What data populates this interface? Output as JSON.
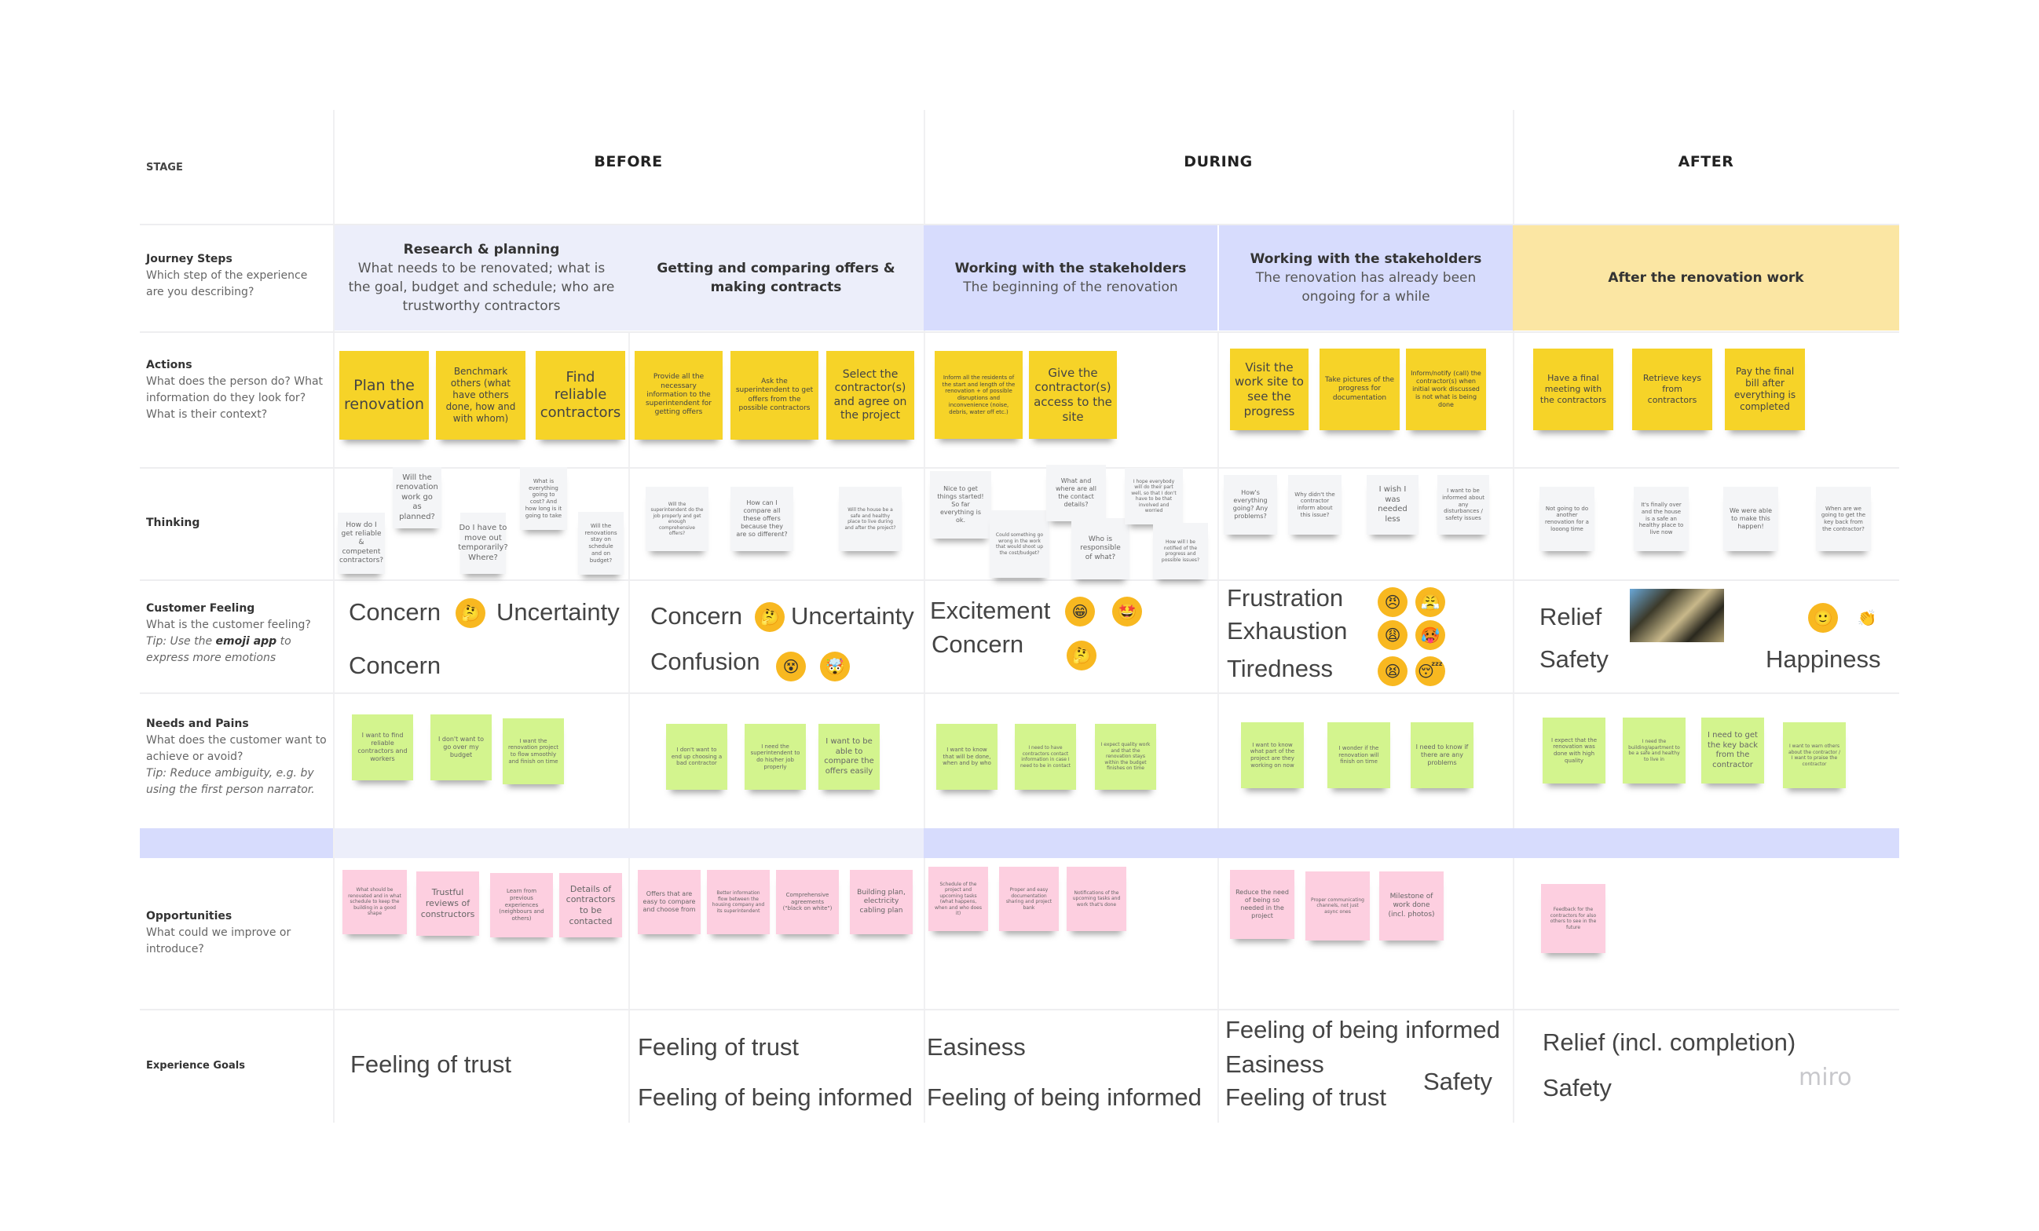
{
  "row_labels": {
    "stage": "STAGE",
    "journey": {
      "title": "Journey Steps",
      "desc": "Which step of the experience are you describing?"
    },
    "actions": {
      "title": "Actions",
      "desc": "What does the person do? What information do they look for? What is their context?"
    },
    "thinking": {
      "title": "Thinking"
    },
    "feeling": {
      "title": "Customer Feeling",
      "desc": "What is the customer feeling?",
      "tip_prefix": "Tip: Use the ",
      "tip_bold": "emoji app",
      "tip_suffix": " to express more emotions"
    },
    "needs": {
      "title": "Needs and Pains",
      "desc": "What does the customer want to achieve or avoid?",
      "tip": "Tip: Reduce ambiguity, e.g. by using the first person narrator."
    },
    "opportunities": {
      "title": "Opportunities",
      "desc": "What could we improve or introduce?"
    },
    "goals": {
      "title": "Experience Goals"
    }
  },
  "stages": [
    "BEFORE",
    "DURING",
    "AFTER"
  ],
  "journey_steps": [
    {
      "title": "Research & planning",
      "desc": "What needs to be renovated; what is the goal, budget and schedule; who are trustworthy contractors"
    },
    {
      "title": "Getting and comparing offers & making contracts",
      "desc": ""
    },
    {
      "title": "Working with the stakeholders",
      "desc": "The beginning of the renovation"
    },
    {
      "title": "Working with the stakeholders",
      "desc": "The renovation has already been ongoing for a while"
    },
    {
      "title": "After the renovation work",
      "desc": ""
    }
  ],
  "colors": {
    "before_band": "#eceefa",
    "during_band": "#d7dcfd",
    "after_band": "#fbe6a3",
    "sticky_yellow": "#f6d328",
    "sticky_green": "#d3f48e",
    "sticky_pink": "#fdcfe0",
    "sticky_white": "#f4f5f7"
  },
  "actions": [
    "Plan the renovation",
    "Benchmark others (what have others done, how and with whom)",
    "Find reliable contractors",
    "Provide all the necessary information to the superintendent for getting offers",
    "Ask the superintendent to get offers from the possible contractors",
    "Select the contractor(s) and agree on the project",
    "Inform all the residents of the start and length of the renovation + of possible disruptions and inconvenience (noise, debris, water off etc.)",
    "Give the contractor(s) access to the site",
    "Visit the work site to see the progress",
    "Take pictures of the progress for documentation",
    "Inform/notify (call) the contractor(s) when initial work discussed is not what is being done",
    "Have a final meeting with the contractors",
    "Retrieve keys from contractors",
    "Pay the final bill after everything is completed"
  ],
  "thinking": [
    "How do I get reliable & competent contractors?",
    "Will the renovation work go as planned?",
    "Do I have to move out temporarily? Where?",
    "What is everything going to cost? And how long is it going to take",
    "Will the renovations stay on schedule and on budget?",
    "Will the superintendent do the job properly and get enough comprehensive offers?",
    "How can I compare all these offers because they are so different?",
    "Will the house be a safe and healthy place to live during and after the project?",
    "Nice to get things started! So far everything is ok.",
    "Could something go wrong in the work that would shoot up the cost/budget?",
    "What and where are all the contact details?",
    "Who is responsible of what?",
    "I hope everybody will do their part well, so that I don't have to be that involved and worried",
    "How will I be notified of the progress and possible issues?",
    "How's everything going? Any problems?",
    "Why didn't the contractor inform about this issue?",
    "I wish I was needed less",
    "I want to be informed about any disturbances / safety issues",
    "Not going to do another renovation for a looong time",
    "It's finally over and the house is a safe an healthy place to live now",
    "We were able to make this happen!",
    "When are we going to get the key back from the contractor?"
  ],
  "feelings": [
    {
      "lines": [
        "Concern",
        "Uncertainty",
        "Concern"
      ],
      "emojis": [
        "thinking-face"
      ]
    },
    {
      "lines": [
        "Concern",
        "Uncertainty",
        "Confusion"
      ],
      "emojis": [
        "thinking-face",
        "dizzy-face",
        "exploding-head"
      ]
    },
    {
      "lines": [
        "Excitement",
        "Concern"
      ],
      "emojis": [
        "grinning-face",
        "star-struck",
        "thinking-face"
      ]
    },
    {
      "lines": [
        "Frustration",
        "Exhaustion",
        "Tiredness"
      ],
      "emojis": [
        "angry-face",
        "steam-face",
        "weary-face",
        "hot-face",
        "tired-face",
        "sleeping-face"
      ]
    },
    {
      "lines": [
        "Relief",
        "Safety",
        "Happiness"
      ],
      "emojis": [
        "smiling-face",
        "clapping-hands"
      ],
      "image": "relief-photo"
    }
  ],
  "emoji_glyphs": {
    "thinking-face": "🤔",
    "dizzy-face": "😵",
    "exploding-head": "🤯",
    "grinning-face": "😁",
    "star-struck": "🤩",
    "angry-face": "😠",
    "steam-face": "😤",
    "weary-face": "😩",
    "hot-face": "🥵",
    "tired-face": "😫",
    "sleeping-face": "😴",
    "smiling-face": "🙂",
    "clapping-hands": "👏"
  },
  "needs": [
    "I want to find reliable contractors and workers",
    "I don't want to go over my budget",
    "I want the renovation project to flow smoothly and finish on time",
    "I don't want to end up choosing a bad contractor",
    "I need the superintendent to do his/her job properly",
    "I want to be able to compare the offers easily",
    "I want to know that will be done, when and by who",
    "I need to have contractors contact information in case I need to be in contact",
    "I expect quality work and that the renovation stays within the budget finishes on time",
    "I want to know what part of the project are they working on now",
    "I wonder if the renovation will finish on time",
    "I need to know if there are any problems",
    "I expect that the renovation was done with high quality",
    "I need the building/apartment to be a safe and healthy to live in",
    "I need to get the key back from the contractor",
    "I want to warn others about the contractor / I want to praise the contractor"
  ],
  "opportunities": [
    "What should be renovated and in what schedule to keep the building in a good shape",
    "Trustful reviews of constructors",
    "Learn from previous experiences (neighbours and others)",
    "Details of contractors to be contacted",
    "Offers that are easy to compare and choose from",
    "Better information flow between the housing company and its superintendent",
    "Comprehensive agreements (\"black on white\")",
    "Building plan, electricity cabling plan",
    "Schedule of the project and upcoming tasks (what happens, when and who does it)",
    "Proper and easy documentation sharing and project bank",
    "Notifications of the upcoming tasks and work that's done",
    "Reduce the need of being so needed in the project",
    "Proper communicating channels, not just async ones",
    "Milestone of work done (incl. photos)",
    "Feedback for the contractors for also others to see in the future"
  ],
  "goals": [
    [
      "Feeling of trust"
    ],
    [
      "Feeling of trust",
      "Feeling of being informed"
    ],
    [
      "Easiness",
      "Feeling of being informed"
    ],
    [
      "Feeling of being informed",
      "Easiness",
      "Safety",
      "Feeling of trust"
    ],
    [
      "Relief (incl. completion)",
      "Safety"
    ]
  ],
  "watermark": "miro"
}
